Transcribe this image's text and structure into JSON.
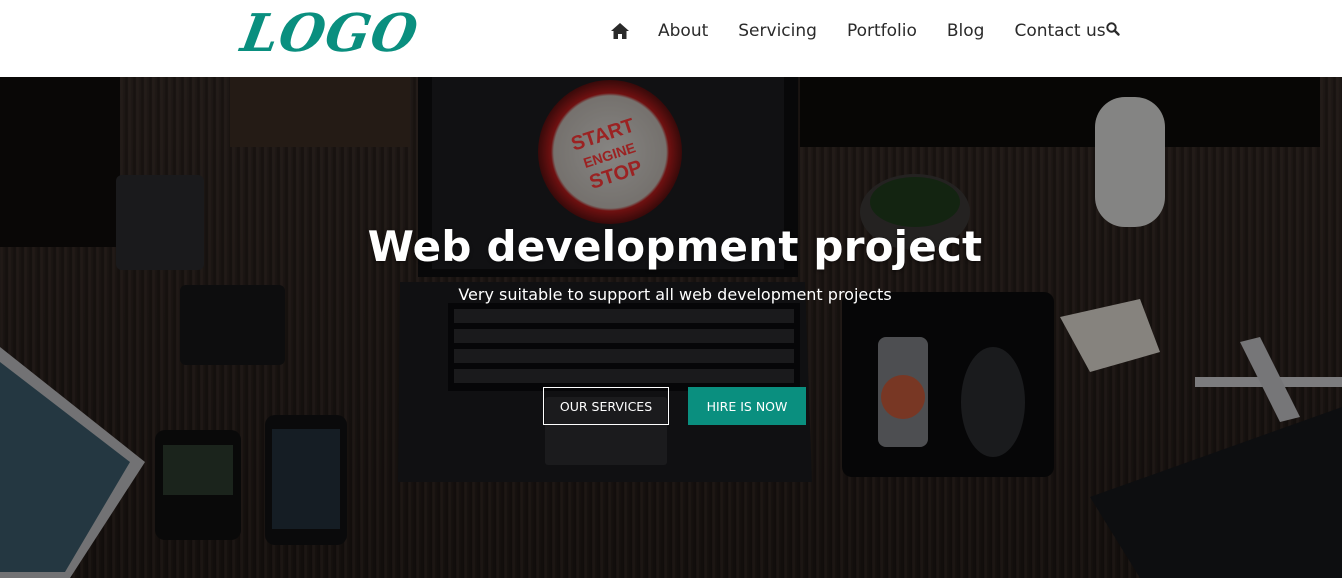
{
  "colors": {
    "brand": "#0a8f7f",
    "nav_text": "#2a2a2a",
    "button_accent": "#0a8f7f",
    "hero_text": "#ffffff"
  },
  "header": {
    "logo_text": "LOGO",
    "home_icon": "home-icon",
    "nav": [
      "About",
      "Servicing",
      "Portfolio",
      "Blog",
      "Contact us"
    ],
    "search_icon": "search-icon"
  },
  "hero": {
    "title": "Web development project",
    "subtitle": "Very suitable to support all web development projects",
    "primary_button": "OUR SERVICES",
    "secondary_button": "HIRE IS NOW",
    "screen_button_text": [
      "START",
      "ENGINE",
      "STOP"
    ]
  }
}
